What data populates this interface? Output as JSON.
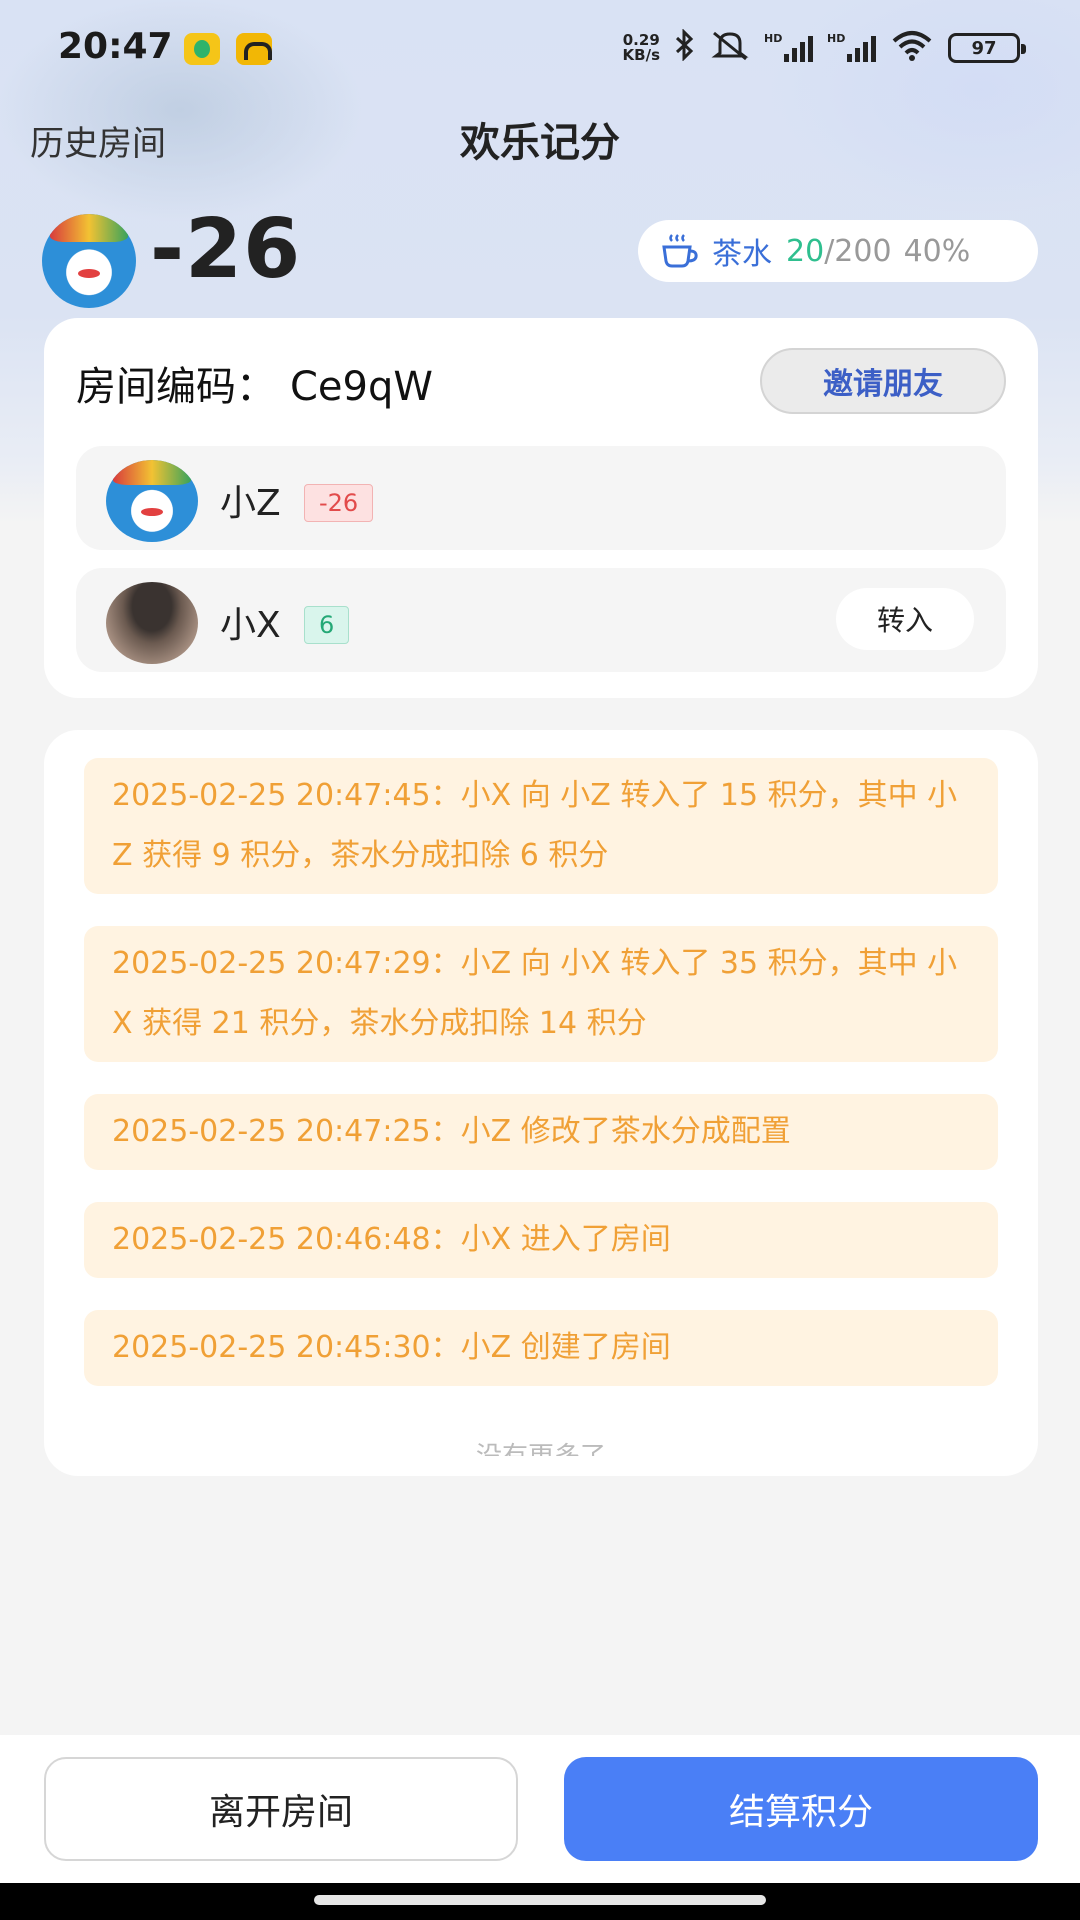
{
  "status_bar": {
    "time": "20:47",
    "app_icons": [
      "qq-music-icon",
      "car-app-icon"
    ],
    "net_speed_value": "0.29",
    "net_speed_unit": "KB/s",
    "icons": [
      "bluetooth-icon",
      "mute-icon",
      "signal-icon",
      "signal-icon",
      "wifi-icon"
    ],
    "hd_label": "HD",
    "battery": "97"
  },
  "header": {
    "history_link": "历史房间",
    "title": "欢乐记分"
  },
  "me": {
    "score": "-26",
    "avatar": "cartoon-cat-avatar"
  },
  "tea": {
    "icon": "tea-cup-icon",
    "label": "茶水",
    "current": "20",
    "total": "/200",
    "percent": "40%",
    "colors": {
      "label": "#3a6fd8",
      "current": "#2fbf8f"
    }
  },
  "room": {
    "code_label": "房间编码：",
    "code": "Ce9qW",
    "invite_button": "邀请朋友",
    "players": [
      {
        "name": "小Z",
        "score": "-26",
        "avatar": "cartoon-cat-avatar"
      },
      {
        "name": "小X",
        "score": "6",
        "avatar": "photo-avatar",
        "action": "转入"
      }
    ]
  },
  "log": {
    "items": [
      "2025-02-25 20:47:45：小X 向 小Z 转入了 15 积分，其中 小Z 获得 9 积分，茶水分成扣除 6 积分",
      "2025-02-25 20:47:29：小Z 向 小X 转入了 35 积分，其中 小X 获得 21 积分，茶水分成扣除 14 积分",
      "2025-02-25 20:47:25：小Z 修改了茶水分成配置",
      "2025-02-25 20:46:48：小X 进入了房间",
      "2025-02-25 20:45:30：小Z 创建了房间"
    ],
    "more_text": "没有更多了",
    "text_color": "#f0a036",
    "bg_color": "#fff3e1"
  },
  "actions": {
    "leave": "离开房间",
    "settle": "结算积分",
    "settle_color": "#4a7ff6"
  }
}
